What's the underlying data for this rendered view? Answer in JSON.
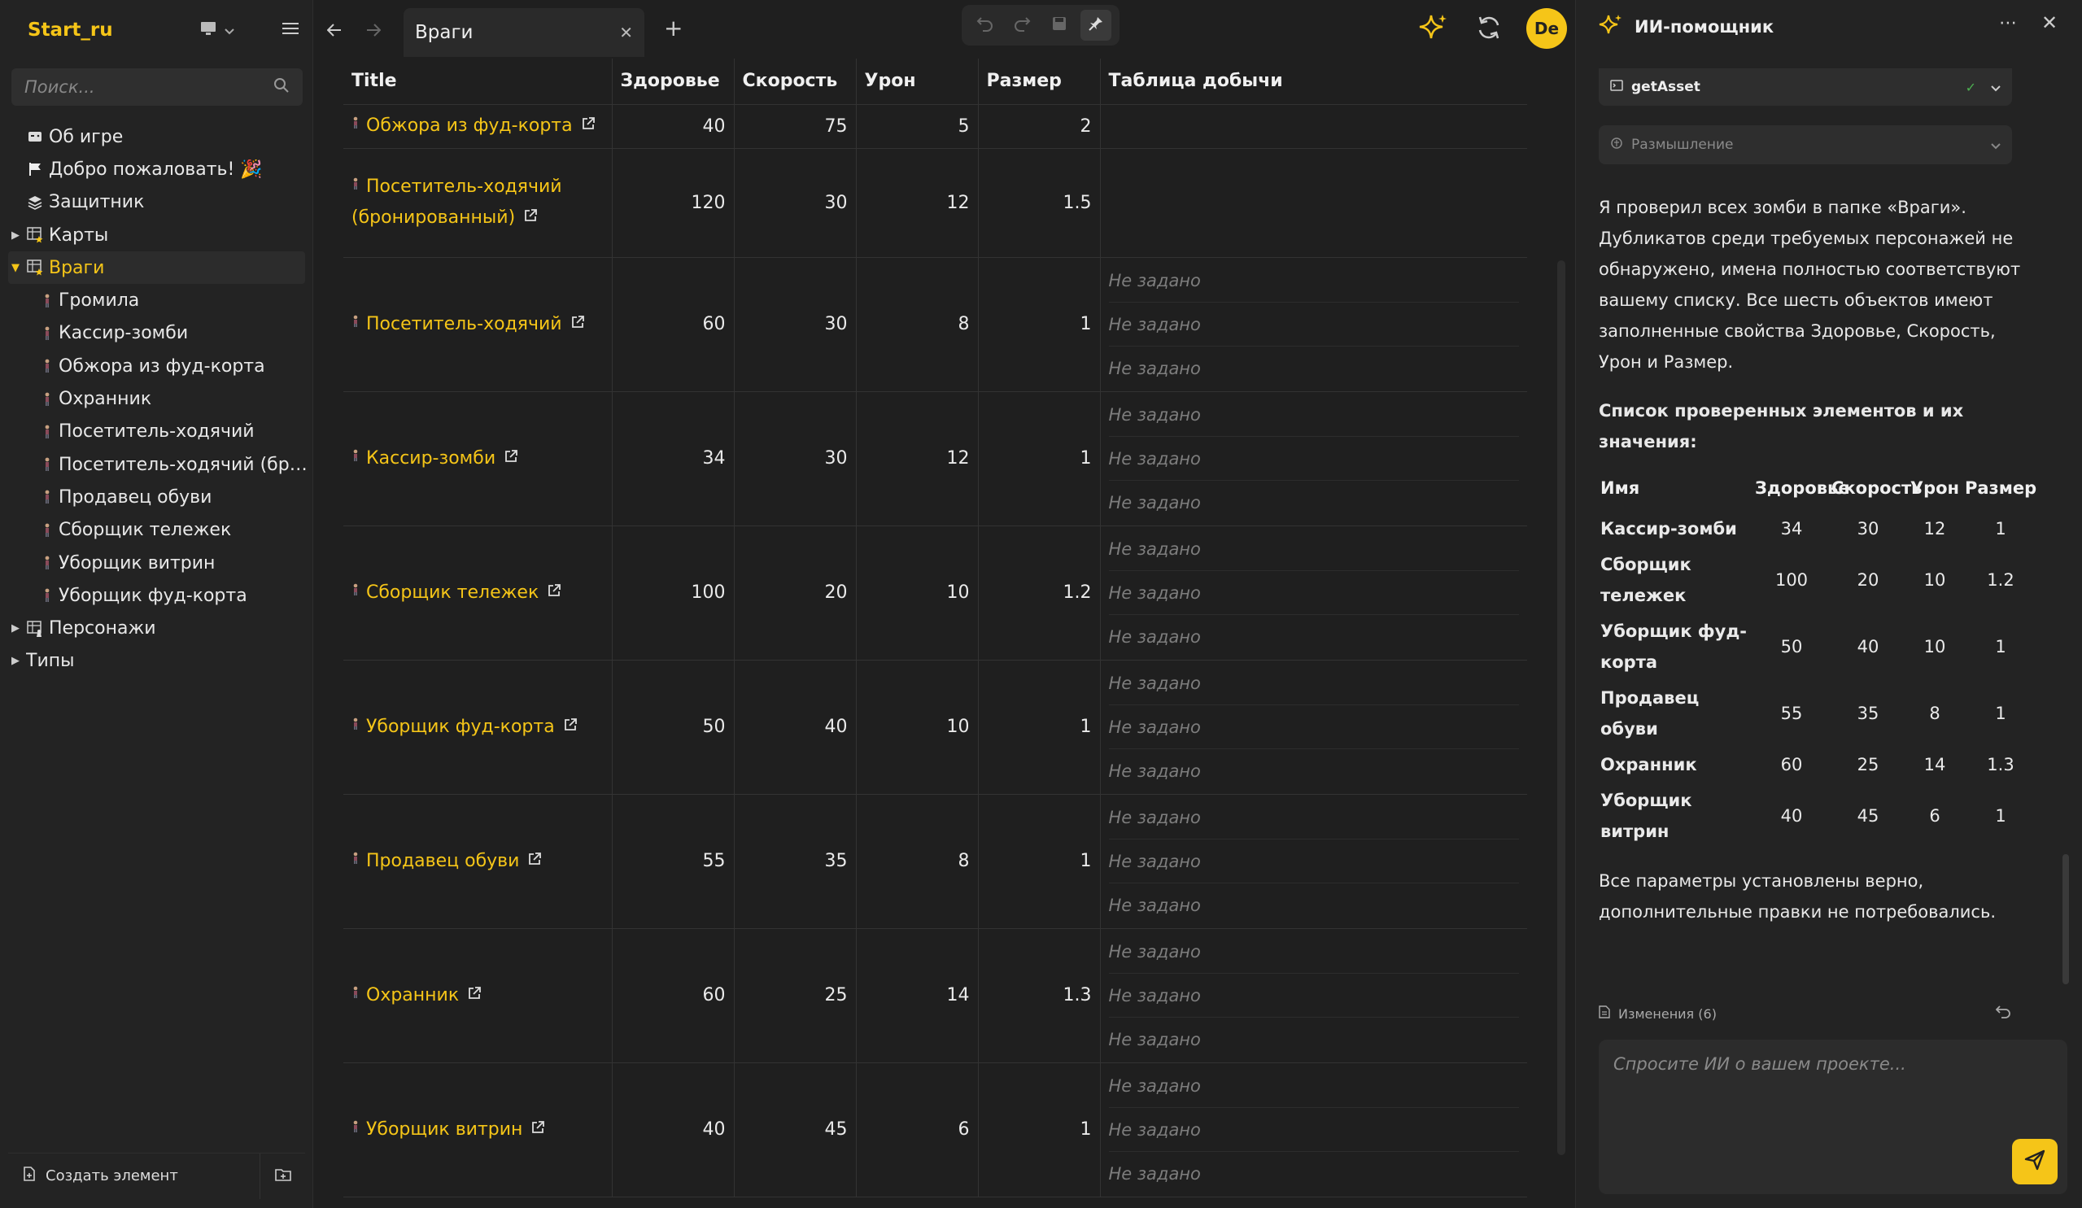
{
  "colors": {
    "accent": "#f5c518",
    "bg": "#1f1f1f",
    "panel": "#232323"
  },
  "project": {
    "name": "Start_ru"
  },
  "search": {
    "placeholder": "Поиск..."
  },
  "tree": {
    "items": [
      {
        "label": "Об игре",
        "icon": "game-icon",
        "level": 0,
        "caret": false
      },
      {
        "label": "Добро пожаловать! 🎉",
        "icon": "flag-icon",
        "level": 0,
        "caret": false
      },
      {
        "label": "Защитник",
        "icon": "layers-icon",
        "level": 0,
        "caret": false
      },
      {
        "label": "Карты",
        "icon": "table-star-icon",
        "level": 0,
        "caret": "closed"
      },
      {
        "label": "Враги",
        "icon": "table-star-icon",
        "level": 0,
        "caret": "open",
        "active": true
      },
      {
        "label": "Громила",
        "icon": "figure-icon",
        "level": 1
      },
      {
        "label": "Кассир-зомби",
        "icon": "figure-icon",
        "level": 1
      },
      {
        "label": "Обжора из фуд-корта",
        "icon": "figure-icon",
        "level": 1
      },
      {
        "label": "Охранник",
        "icon": "figure-icon",
        "level": 1
      },
      {
        "label": "Посетитель-ходячий",
        "icon": "figure-icon",
        "level": 1
      },
      {
        "label": "Посетитель-ходячий (бронированный)",
        "icon": "figure-icon",
        "level": 1
      },
      {
        "label": "Продавец обуви",
        "icon": "figure-icon",
        "level": 1
      },
      {
        "label": "Сборщик тележек",
        "icon": "figure-icon",
        "level": 1
      },
      {
        "label": "Уборщик витрин",
        "icon": "figure-icon",
        "level": 1
      },
      {
        "label": "Уборщик фуд-корта",
        "icon": "figure-icon",
        "level": 1
      },
      {
        "label": "Персонажи",
        "icon": "table-figure-icon",
        "level": 0,
        "caret": "closed"
      },
      {
        "label": "Типы",
        "icon": "",
        "level": 0,
        "caret": "closed"
      }
    ]
  },
  "sidebar_footer": {
    "create_label": "Создать элемент"
  },
  "tab": {
    "label": "Враги"
  },
  "table": {
    "columns": [
      "Title",
      "Здоровье",
      "Скорость",
      "Урон",
      "Размер",
      "Таблица добычи"
    ],
    "empty_text": "Не задано",
    "rows": [
      {
        "title": "Обжора из фуд-корта",
        "health": "40",
        "speed": "75",
        "damage": "5",
        "size": "2",
        "loot": []
      },
      {
        "title": "Посетитель-ходячий (бронированный)",
        "health": "120",
        "speed": "30",
        "damage": "12",
        "size": "1.5",
        "loot": []
      },
      {
        "title": "Посетитель-ходячий",
        "health": "60",
        "speed": "30",
        "damage": "8",
        "size": "1",
        "loot": [
          "Не задано",
          "Не задано",
          "Не задано"
        ]
      },
      {
        "title": "Кассир-зомби",
        "health": "34",
        "speed": "30",
        "damage": "12",
        "size": "1",
        "loot": [
          "Не задано",
          "Не задано",
          "Не задано"
        ]
      },
      {
        "title": "Сборщик тележек",
        "health": "100",
        "speed": "20",
        "damage": "10",
        "size": "1.2",
        "loot": [
          "Не задано",
          "Не задано",
          "Не задано"
        ]
      },
      {
        "title": "Уборщик фуд-корта",
        "health": "50",
        "speed": "40",
        "damage": "10",
        "size": "1",
        "loot": [
          "Не задано",
          "Не задано",
          "Не задано"
        ]
      },
      {
        "title": "Продавец обуви",
        "health": "55",
        "speed": "35",
        "damage": "8",
        "size": "1",
        "loot": [
          "Не задано",
          "Не задано",
          "Не задано"
        ]
      },
      {
        "title": "Охранник",
        "health": "60",
        "speed": "25",
        "damage": "14",
        "size": "1.3",
        "loot": [
          "Не задано",
          "Не задано",
          "Не задано"
        ]
      },
      {
        "title": "Уборщик витрин",
        "health": "40",
        "speed": "45",
        "damage": "6",
        "size": "1",
        "loot": [
          "Не задано",
          "Не задано",
          "Не задано"
        ]
      }
    ]
  },
  "ai": {
    "title": "ИИ-помощник",
    "tool_getasset": "getAsset",
    "thinking_label": "Размышление",
    "message_intro": "Я проверил всех зомби в папке «Враги». Дубликатов среди требуемых персонажей не обнаружено, имена полностью соответствуют вашему списку. Все шесть объектов имеют заполненные свойства Здоровье, Скорость, Урон и Размер.",
    "list_heading": "Список проверенных элементов и их значения:",
    "mini_table": {
      "headers": [
        "Имя",
        "Здоровье",
        "Скорость",
        "Урон",
        "Размер"
      ],
      "rows": [
        [
          "Кассир-зомби",
          "34",
          "30",
          "12",
          "1"
        ],
        [
          "Сборщик тележек",
          "100",
          "20",
          "10",
          "1.2"
        ],
        [
          "Уборщик фуд-корта",
          "50",
          "40",
          "10",
          "1"
        ],
        [
          "Продавец обуви",
          "55",
          "35",
          "8",
          "1"
        ],
        [
          "Охранник",
          "60",
          "25",
          "14",
          "1.3"
        ],
        [
          "Уборщик витрин",
          "40",
          "45",
          "6",
          "1"
        ]
      ]
    },
    "message_outro": "Все параметры установлены верно, дополнительные правки не потребовались.",
    "changes_label": "Изменения (6)",
    "input_placeholder": "Спросите ИИ о вашем проекте..."
  }
}
